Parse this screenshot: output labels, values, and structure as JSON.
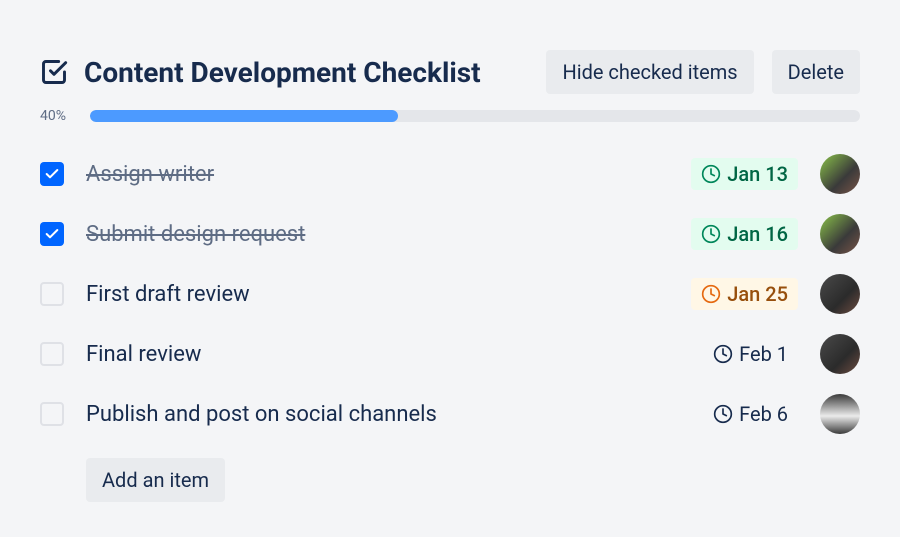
{
  "checklist": {
    "title": "Content Development Checklist",
    "hide_checked_label": "Hide checked items",
    "delete_label": "Delete",
    "progress_pct_label": "40%",
    "progress_pct_value": 40,
    "add_item_label": "Add an item",
    "items": [
      {
        "label": "Assign writer",
        "checked": true,
        "date": "Jan 13",
        "date_status": "green",
        "assignee": "a1"
      },
      {
        "label": "Submit design request",
        "checked": true,
        "date": "Jan 16",
        "date_status": "green",
        "assignee": "a1"
      },
      {
        "label": "First draft review",
        "checked": false,
        "date": "Jan 25",
        "date_status": "orange",
        "assignee": "a2"
      },
      {
        "label": "Final review",
        "checked": false,
        "date": "Feb 1",
        "date_status": "plain",
        "assignee": "a2"
      },
      {
        "label": "Publish and post on social channels",
        "checked": false,
        "date": "Feb 6",
        "date_status": "plain",
        "assignee": "a3"
      }
    ]
  }
}
